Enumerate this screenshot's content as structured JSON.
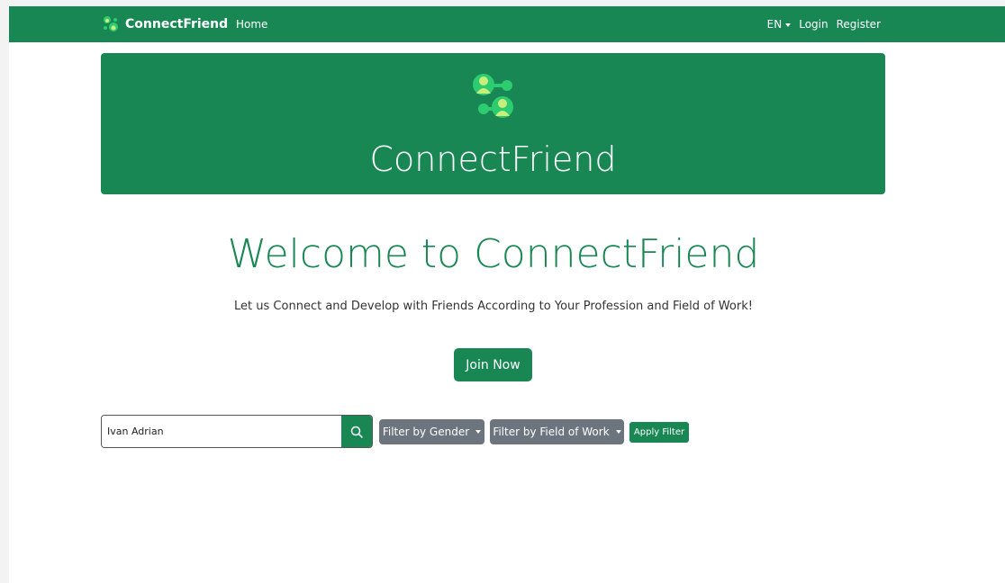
{
  "navbar": {
    "brand": "ConnectFriend",
    "home": "Home",
    "language": "EN",
    "login": "Login",
    "register": "Register"
  },
  "hero": {
    "title": "ConnectFriend",
    "logo_icon": "connect-friends-logo-icon"
  },
  "main": {
    "heading": "Welcome to ConnectFriend",
    "subtitle": "Let us Connect and Develop with Friends According to Your Profession and Field of Work!",
    "join_button": "Join Now"
  },
  "search": {
    "value": "Ivan Adrian",
    "icon": "search-icon"
  },
  "filters": {
    "gender_label": "Filter by Gender",
    "field_label": "Filter by Field of Work",
    "apply_label": "Apply Filter"
  },
  "colors": {
    "primary": "#198754",
    "secondary": "#6c757d"
  }
}
